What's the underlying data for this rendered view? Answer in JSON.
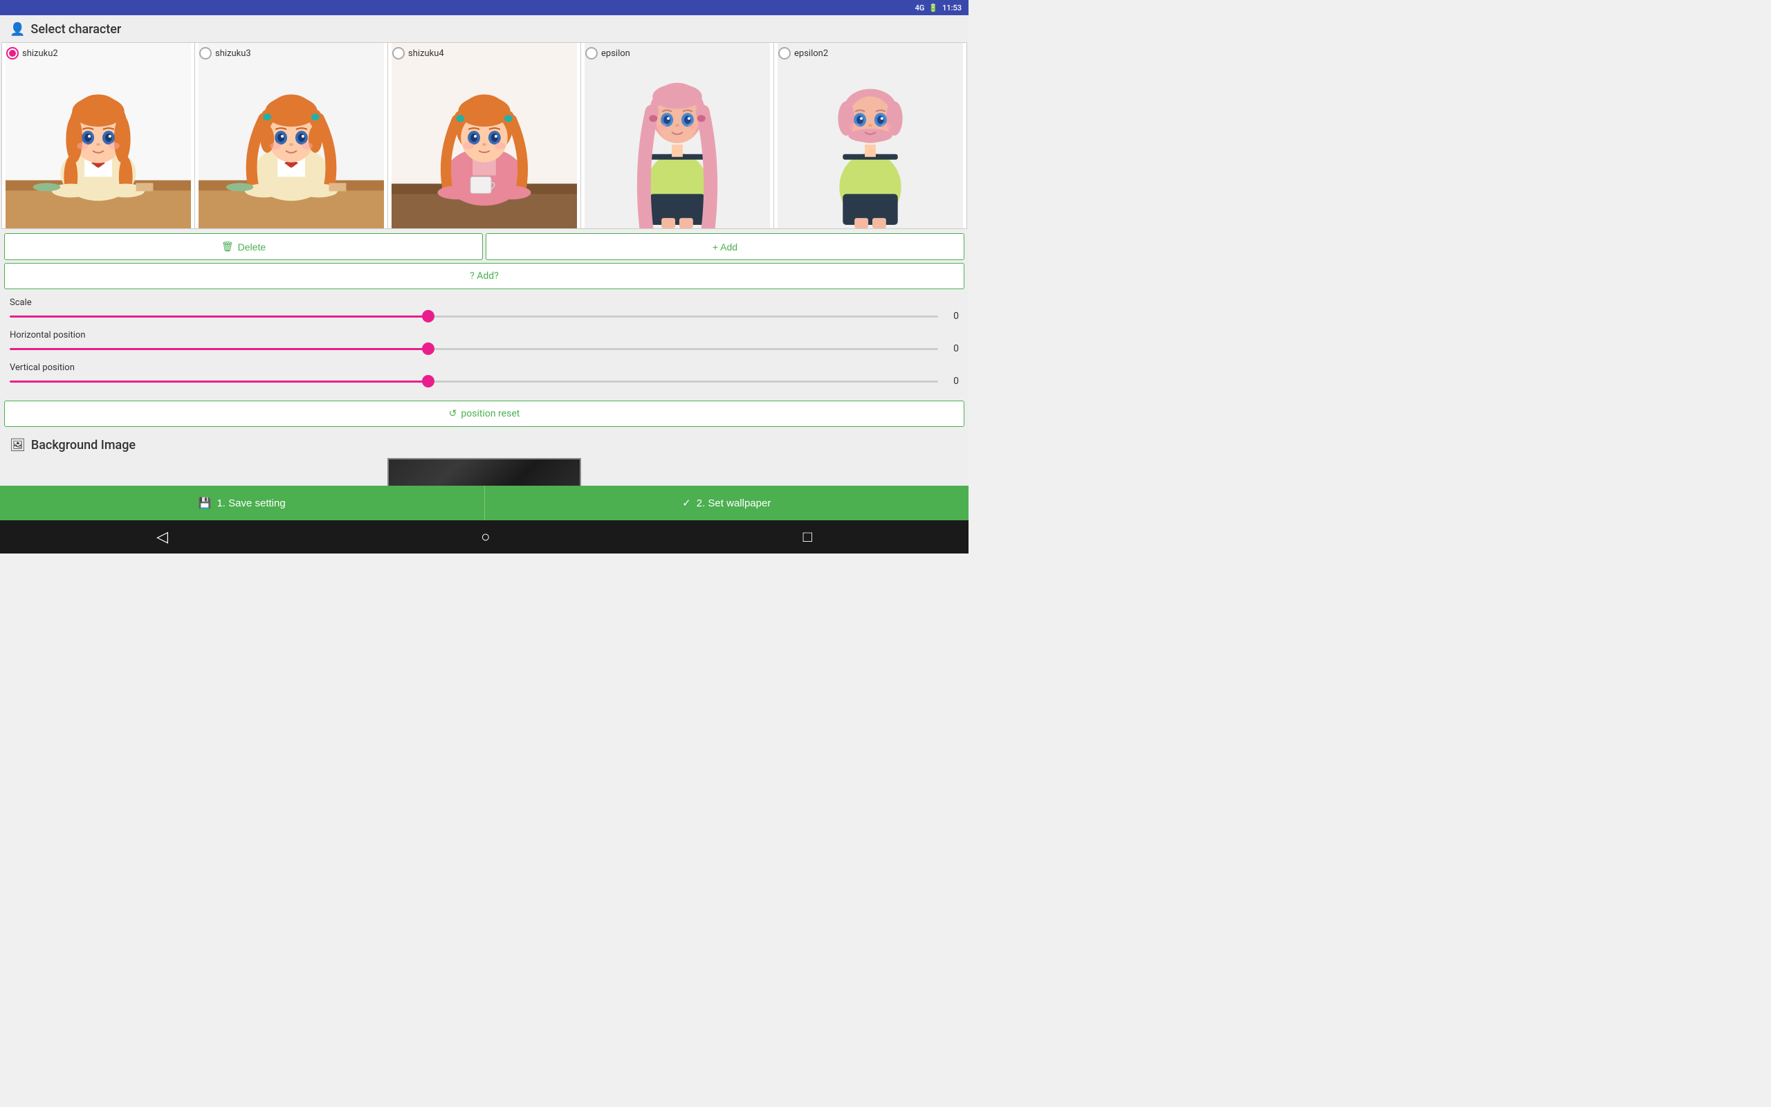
{
  "statusBar": {
    "signal": "4G",
    "battery": "🔋",
    "time": "11:53"
  },
  "selectCharacter": {
    "title": "Select character",
    "characters": [
      {
        "id": "shizuku2",
        "name": "shizuku2",
        "selected": true
      },
      {
        "id": "shizuku3",
        "name": "shizuku3",
        "selected": false
      },
      {
        "id": "shizuku4",
        "name": "shizuku4",
        "selected": false
      },
      {
        "id": "epsilon",
        "name": "epsilon",
        "selected": false
      },
      {
        "id": "epsilon2",
        "name": "epsilon2",
        "selected": false
      }
    ]
  },
  "buttons": {
    "delete": "Delete",
    "add": "+ Add",
    "addQuery": "? Add?",
    "positionReset": "position reset"
  },
  "sliders": {
    "scale": {
      "label": "Scale",
      "value": "0",
      "percent": 45
    },
    "horizontal": {
      "label": "Horizontal position",
      "value": "0",
      "percent": 45
    },
    "vertical": {
      "label": "Vertical position",
      "value": "0",
      "percent": 45
    }
  },
  "backgroundImage": {
    "title": "Background Image"
  },
  "actions": {
    "save": "1. Save setting",
    "setWallpaper": "2. Set wallpaper"
  },
  "nav": {
    "back": "◁",
    "home": "○",
    "square": "□"
  }
}
